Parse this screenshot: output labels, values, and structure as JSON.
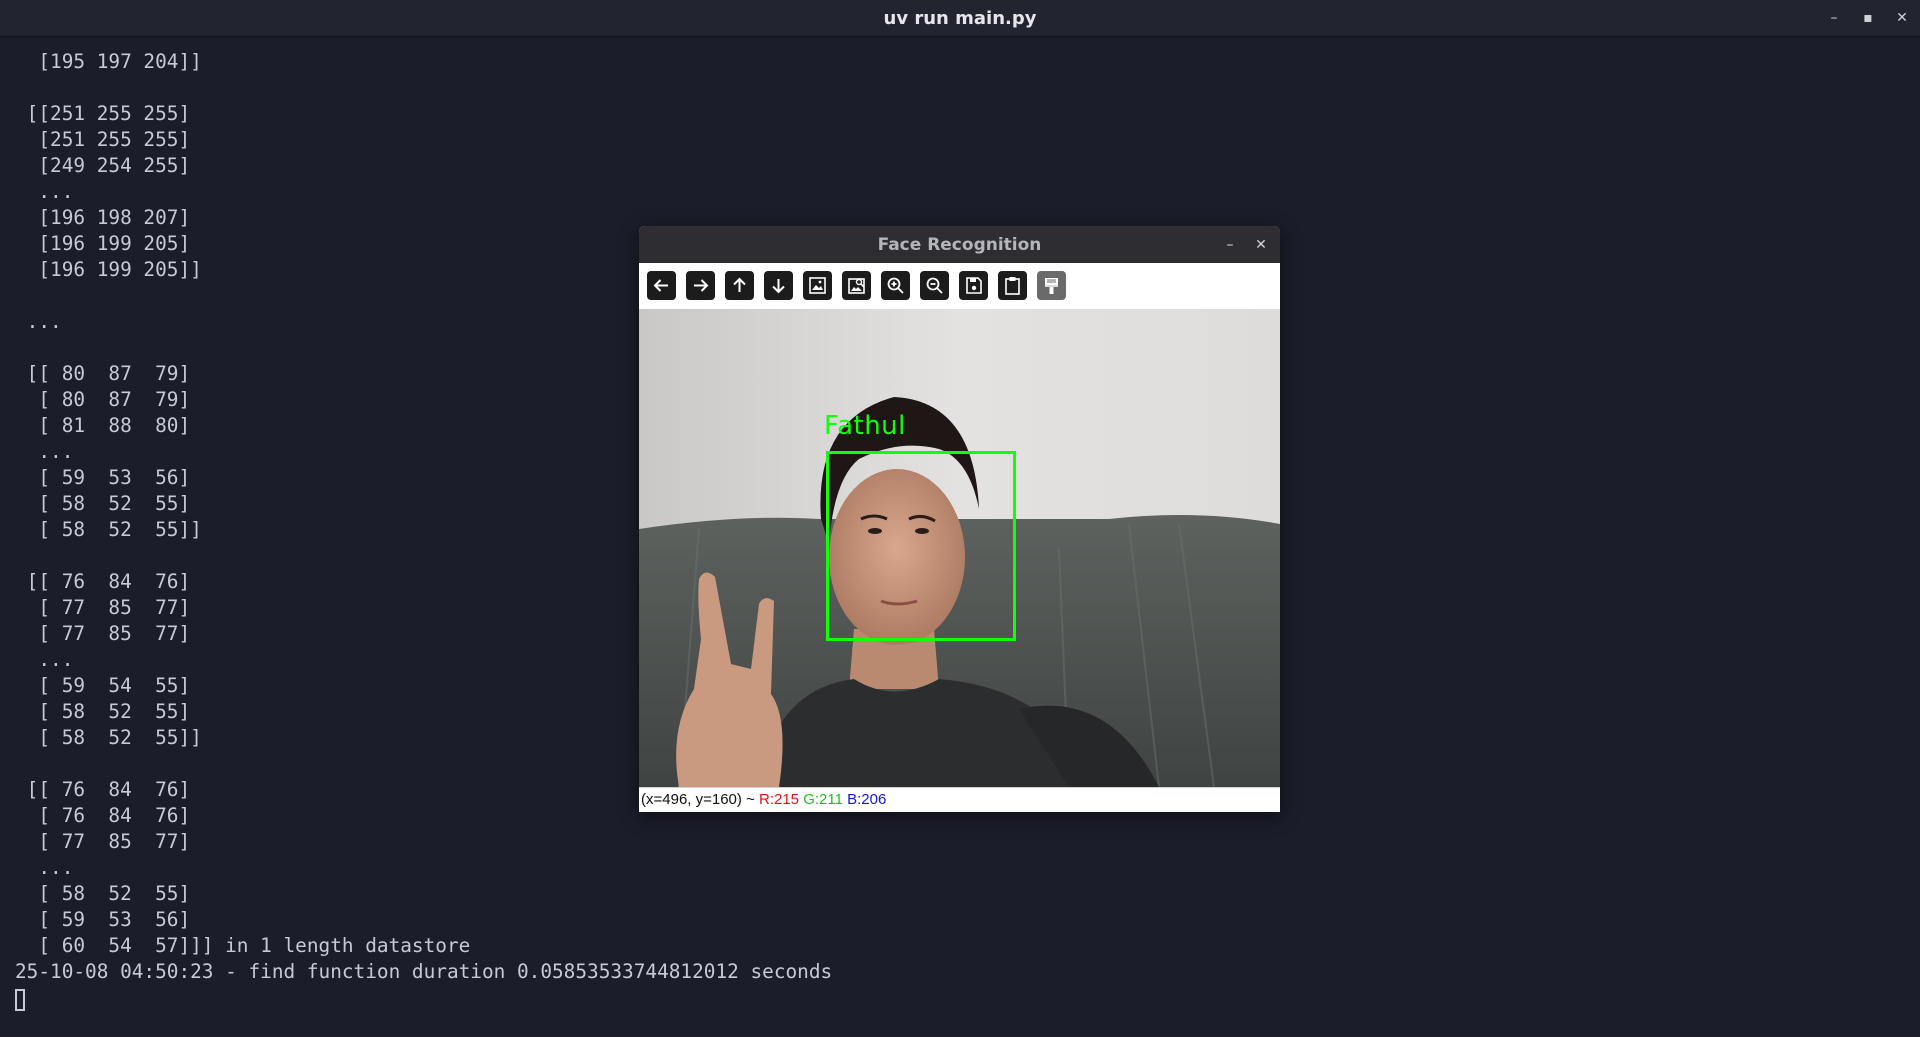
{
  "terminal_window": {
    "title": "uv run main.py",
    "buttons": {
      "minimize": "–",
      "maximize": "▪",
      "close": "✕"
    }
  },
  "terminal": {
    "lines": [
      "  [195 197 204]]",
      "",
      " [[251 255 255]",
      "  [251 255 255]",
      "  [249 254 255]",
      "  ...",
      "  [196 198 207]",
      "  [196 199 205]",
      "  [196 199 205]]",
      "",
      " ...",
      "",
      " [[ 80  87  79]",
      "  [ 80  87  79]",
      "  [ 81  88  80]",
      "  ...",
      "  [ 59  53  56]",
      "  [ 58  52  55]",
      "  [ 58  52  55]]",
      "",
      " [[ 76  84  76]",
      "  [ 77  85  77]",
      "  [ 77  85  77]",
      "  ...",
      "  [ 59  54  55]",
      "  [ 58  52  55]",
      "  [ 58  52  55]]",
      "",
      " [[ 76  84  76]",
      "  [ 76  84  76]",
      "  [ 77  85  77]",
      "  ...",
      "  [ 58  52  55]",
      "  [ 59  53  56]",
      "  [ 60  54  57]]] in 1 length datastore",
      "25-10-08 04:50:23 - find function duration 0.05853533744812012 seconds"
    ]
  },
  "face_window": {
    "title": "Face Recognition",
    "minimize": "–",
    "close": "✕",
    "toolbar": [
      "arrow-left-icon",
      "arrow-right-icon",
      "arrow-up-icon",
      "arrow-down-icon",
      "image-icon",
      "zoom-fit-icon",
      "zoom-in-icon",
      "zoom-out-icon",
      "save-icon",
      "clipboard-icon",
      "settings-icon"
    ],
    "detection": {
      "name": "Fathul",
      "box_color": "#12ff0c"
    },
    "status": {
      "coords": "(x=496, y=160) ~",
      "r": "R:215",
      "g": "G:211",
      "b": "B:206"
    }
  }
}
